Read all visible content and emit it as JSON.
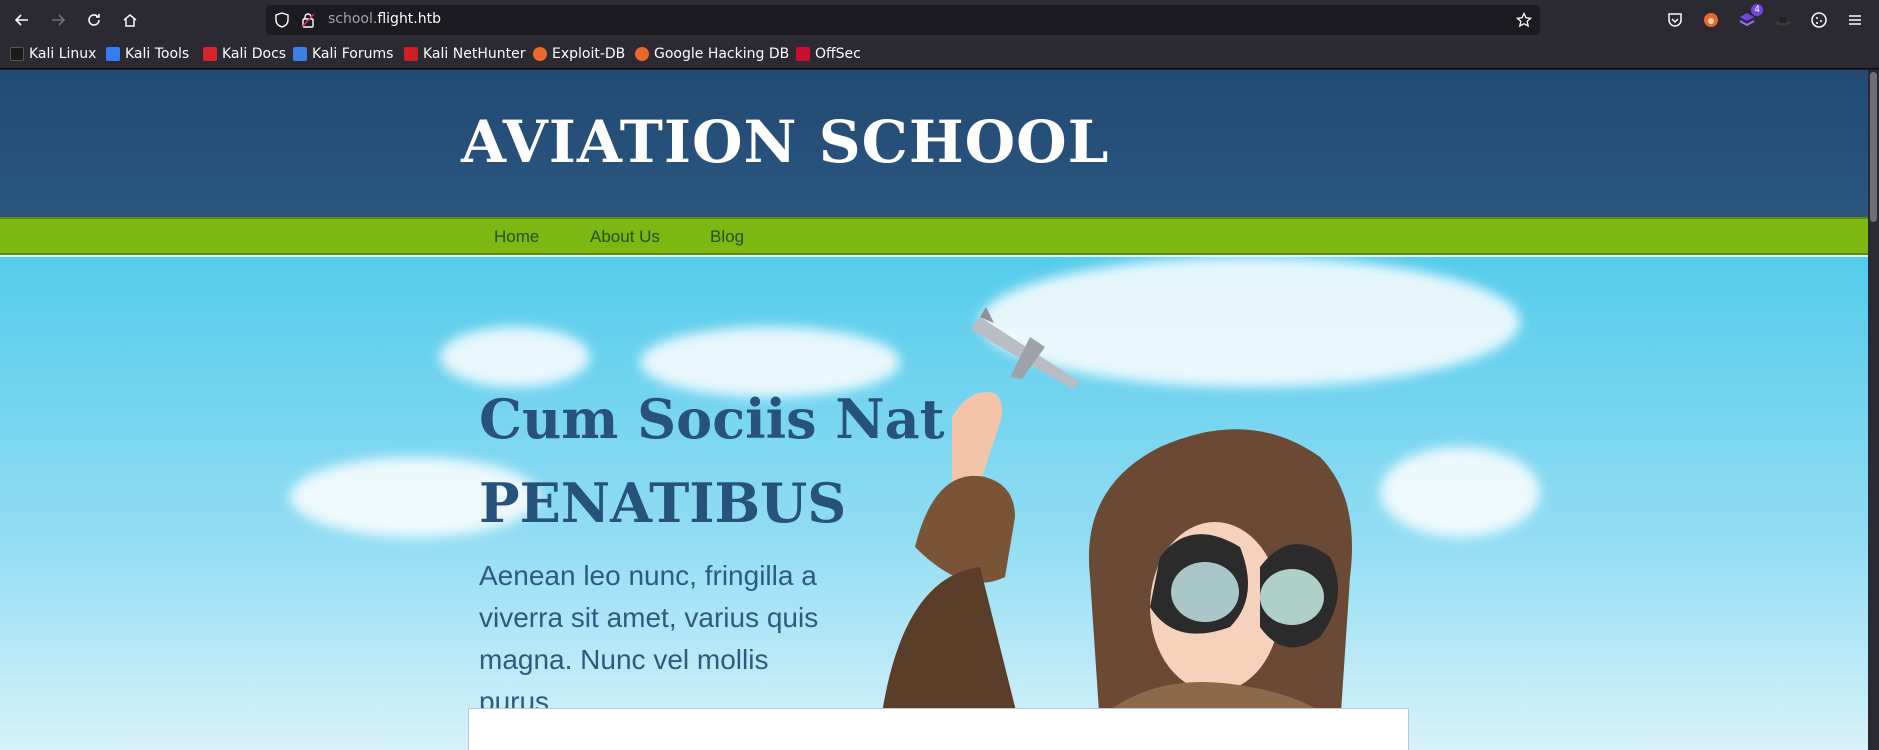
{
  "browser": {
    "url_prefix": "school.",
    "url_domain": "flight.htb",
    "extension_badge": "4",
    "bookmarks": [
      {
        "label": "Kali Linux",
        "icon": "kali-dragon-icon"
      },
      {
        "label": "Kali Tools",
        "icon": "kali-tools-icon"
      },
      {
        "label": "Kali Docs",
        "icon": "kali-docs-icon"
      },
      {
        "label": "Kali Forums",
        "icon": "kali-forums-icon"
      },
      {
        "label": "Kali NetHunter",
        "icon": "nethunter-icon"
      },
      {
        "label": "Exploit-DB",
        "icon": "exploit-db-icon"
      },
      {
        "label": "Google Hacking DB",
        "icon": "ghdb-icon"
      },
      {
        "label": "OffSec",
        "icon": "offsec-icon"
      }
    ]
  },
  "site": {
    "title": "AVIATION SCHOOL",
    "menu": [
      "Home",
      "About Us",
      "Blog"
    ],
    "hero_heading_line1": "Cum Sociis Nat",
    "hero_heading_line2": "PENATIBUS",
    "hero_text": "Aenean leo nunc, fringilla a viverra sit amet, varius quis magna. Nunc vel mollis purus."
  },
  "colors": {
    "header_bg": "#2a5680",
    "menu_bg": "#7cb712",
    "heading": "#27527b"
  }
}
